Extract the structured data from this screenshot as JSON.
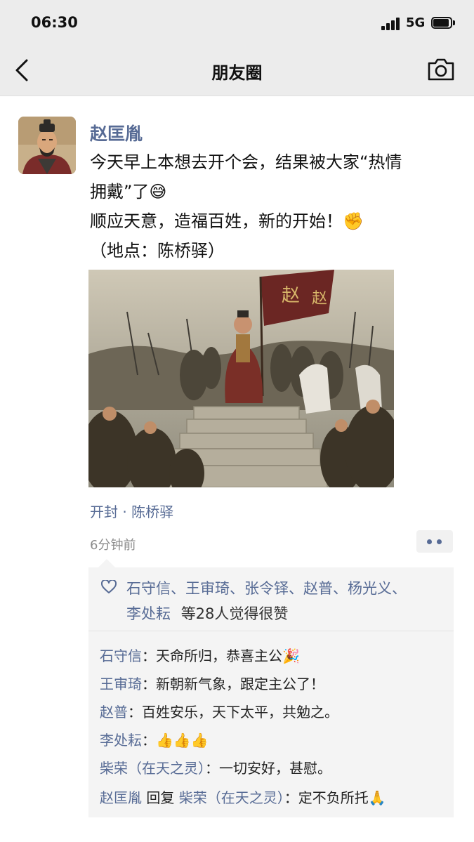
{
  "status_bar": {
    "time": "06:30",
    "network": "5G"
  },
  "nav": {
    "title": "朋友圈",
    "back_icon": "chevron-left-icon",
    "camera_icon": "camera-icon"
  },
  "post": {
    "author": "赵匡胤",
    "text_lines": [
      "今天早上本想去开个会，结果被大家“热情",
      "拥戴”了😅",
      "顺应天意，造福百姓，新的开始！✊",
      "（地点：陈桥驿）"
    ],
    "image_banner_text": "赵",
    "location": "开封 · 陈桥驿",
    "time_ago": "6分钟前"
  },
  "likes": {
    "line1": "石守信、王审琦、张令铎、赵普、杨光义、",
    "line2_names": "李处耘",
    "line2_suffix": "等28人觉得很赞"
  },
  "comments": [
    {
      "who": "石守信",
      "sep": "：",
      "text": "天命所归，恭喜主公🎉"
    },
    {
      "who": "王审琦",
      "sep": "：",
      "text": "新朝新气象，跟定主公了！"
    },
    {
      "who": "赵普",
      "sep": "：",
      "text": "百姓安乐，天下太平，共勉之。"
    },
    {
      "who": "李处耘",
      "sep": "：",
      "text": "👍👍👍"
    },
    {
      "who": "柴荣（在天之灵）",
      "sep": "：",
      "text": "一切安好，甚慰。"
    },
    {
      "who": "赵匡胤",
      "reply_word": " 回复 ",
      "to": "柴荣（在天之灵）",
      "sep": "：",
      "text": "定不负所托🙏"
    }
  ],
  "colors": {
    "link": "#576b95",
    "nav_bg": "#ececec",
    "comment_bg": "#f4f4f4"
  }
}
